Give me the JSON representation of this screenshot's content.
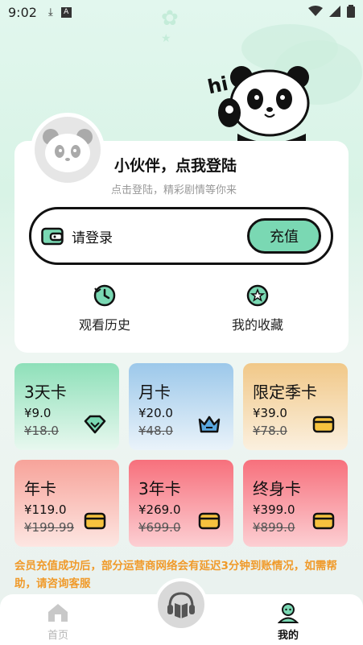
{
  "status_bar": {
    "time": "9:02"
  },
  "profile": {
    "greeting": "小伙伴，点我登陆",
    "subtitle": "点击登陆，精彩剧情等你来",
    "login_text": "请登录",
    "recharge_label": "充值"
  },
  "quick_actions": [
    {
      "label": "观看历史",
      "icon": "history-clock-icon"
    },
    {
      "label": "我的收藏",
      "icon": "star-favorite-icon"
    }
  ],
  "vip_cards": [
    {
      "name": "3天卡",
      "price": "¥9.0",
      "original": "¥18.0",
      "icon": "gem-icon",
      "color_top": "#8ee0b9",
      "color_bottom": "#e8f8ef"
    },
    {
      "name": "月卡",
      "price": "¥20.0",
      "original": "¥48.0",
      "icon": "crown-icon",
      "color_top": "#9cc8ea",
      "color_bottom": "#eaf3fa"
    },
    {
      "name": "限定季卡",
      "price": "¥39.0",
      "original": "¥78.0",
      "icon": "wallet-card-icon",
      "color_top": "#f1c888",
      "color_bottom": "#fbf0df"
    },
    {
      "name": "年卡",
      "price": "¥119.0",
      "original": "¥199.99",
      "icon": "wallet-card-icon",
      "color_top": "#f7a39a",
      "color_bottom": "#fde6e2"
    },
    {
      "name": "3年卡",
      "price": "¥269.0",
      "original": "¥699.0",
      "icon": "wallet-card-icon",
      "color_top": "#f7707c",
      "color_bottom": "#fccfd3"
    },
    {
      "name": "终身卡",
      "price": "¥399.0",
      "original": "¥899.0",
      "icon": "wallet-card-icon",
      "color_top": "#f7707c",
      "color_bottom": "#fccfd3"
    }
  ],
  "notice": "会员充值成功后，部分运营商网络会有延迟3分钟到账情况，如需帮助，请咨询客服",
  "bottom_nav": {
    "home_label": "首页",
    "mine_label": "我的"
  },
  "colors": {
    "accent_green": "#7ad8b3",
    "notice_orange": "#f09a2a",
    "nav_active": "#111111",
    "nav_inactive": "#b5b5b5"
  }
}
